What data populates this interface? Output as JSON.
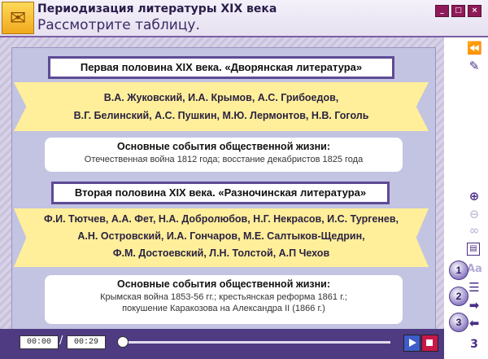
{
  "window": {
    "title": "Периодизация литературы XIX века",
    "subtitle": "Рассмотрите таблицу."
  },
  "sections": [
    {
      "header": "Первая половина XIX века. «Дворянская литература»",
      "authors": [
        "В.А. Жуковский, И.А. Крымов, А.С. Грибоедов,",
        "В.Г. Белинский, А.С. Пушкин, М.Ю. Лермонтов, Н.В. Гоголь"
      ],
      "events_title": "Основные события общественной жизни:",
      "events": [
        "Отечественная война 1812 года; восстание декабристов 1825 года"
      ]
    },
    {
      "header": "Вторая половина XIX века. «Разночинская литература»",
      "authors": [
        "Ф.И. Тютчев, А.А. Фет, Н.А. Добролюбов, Н.Г. Некрасов, И.С. Тургенев,",
        "А.Н. Островский, И.А. Гончаров, М.Е. Салтыков-Щедрин,",
        "Ф.М. Достоевский, Л.Н. Толстой, А.П Чехов"
      ],
      "events_title": "Основные события общественной жизни:",
      "events": [
        "Крымская война 1853-56 гг.; крестьянская реформа 1861 г.;",
        "покушение Каракозова на Александра II (1866 г.)"
      ]
    }
  ],
  "player": {
    "current_time": "00:00",
    "separator": "/",
    "total_time": "00:29",
    "progress": 0
  },
  "sidebar": {
    "icons": [
      "rewind-icon",
      "pencil-icon",
      "zoom-in-icon",
      "zoom-out-icon",
      "link-icon",
      "document-icon",
      "font-size-icon",
      "list-icon",
      "forward-arrow-icon",
      "back-arrow-icon"
    ],
    "font_label": "Aa",
    "number_buttons": [
      "1",
      "2",
      "3"
    ],
    "page_number": "3"
  }
}
